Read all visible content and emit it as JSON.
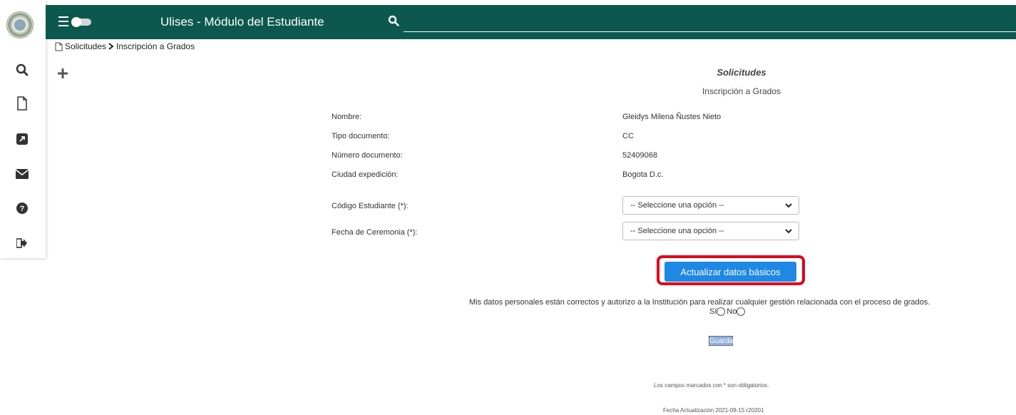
{
  "app": {
    "title": "Ulises - Módulo del Estudiante"
  },
  "search": {
    "placeholder": ""
  },
  "breadcrumb": {
    "root": "Solicitudes",
    "current": "Inscripción a Grados"
  },
  "sidebar": {
    "icons": [
      "search-icon",
      "file-icon",
      "external-link-icon",
      "envelope-icon",
      "question-circle-icon",
      "sign-out-icon"
    ]
  },
  "form": {
    "title": "Solicitudes",
    "subtitle": "Inscripción a Grados",
    "fields": [
      {
        "label": "Nombre:",
        "value": "Gleidys Milena Ñustes Nieto"
      },
      {
        "label": "Tipo documento:",
        "value": "CC"
      },
      {
        "label": "Número documento:",
        "value": "52409068"
      },
      {
        "label": "Ciudad expedición:",
        "value": "Bogota D.c."
      }
    ],
    "student_code": {
      "label": "Código Estudiante (*):",
      "selected": "-- Seleccione una opción --"
    },
    "ceremony_date": {
      "label": "Fecha de Ceremonia (*):",
      "selected": "-- Seleccione una opción --"
    },
    "update_button": "Actualizar datos básicos",
    "authorization": "Mis datos personales están correctos y autorizo a la Institución para realizar cualquier gestión relacionada con el proceso de grados.",
    "yes_label": "Sí",
    "no_label": "No",
    "save_button": "Guardar",
    "required_note": "Los campos marcados con * son obligatorios.",
    "updated": "Fecha Actualización 2021-09-15 r20201"
  },
  "colors": {
    "topbar": "#0c584e",
    "button": "#1e88e5",
    "highlight": "#e1001a"
  }
}
